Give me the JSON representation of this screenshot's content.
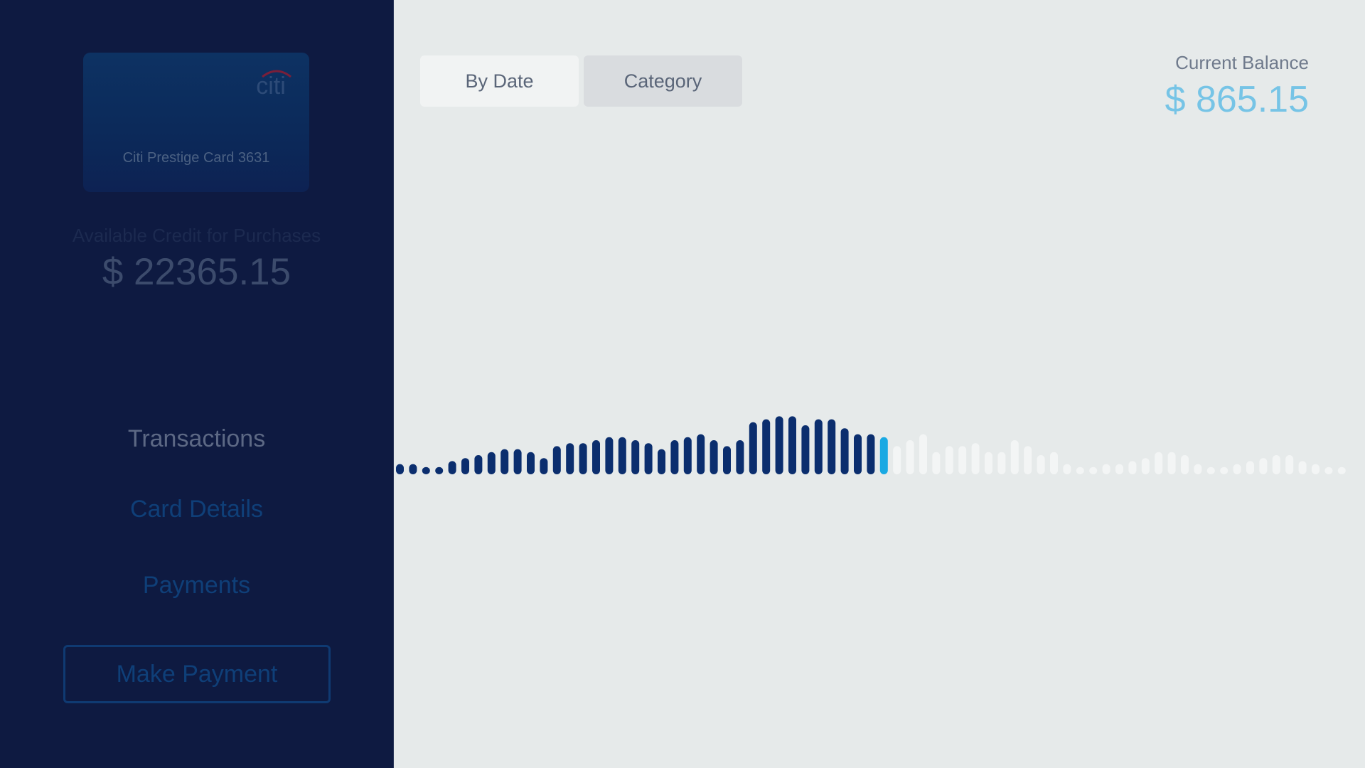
{
  "sidebar": {
    "card": {
      "brand": "citi",
      "name": "Citi Prestige Card 3631",
      "logo_arc_color": "#7a1f3a"
    },
    "available_credit_label": "Available Credit for Purchases",
    "available_credit_value": "$ 22365.15",
    "nav": [
      {
        "label": "Transactions",
        "state": "active"
      },
      {
        "label": "Card Details"
      },
      {
        "label": "Payments"
      }
    ],
    "make_payment_label": "Make Payment"
  },
  "tabs": [
    {
      "label": "By Date",
      "selected": true
    },
    {
      "label": "Category",
      "selected": false
    }
  ],
  "balance": {
    "label": "Current Balance",
    "value": "$ 865.15"
  },
  "colors": {
    "sidebar_bg": "#0e1a41",
    "content_bg": "#e6eaea",
    "past_bar": "#0b2e6e",
    "selected_bar": "#19a9e3",
    "future_bar": "#f3f5f5",
    "balance_accent": "#76c4e6"
  },
  "chart_data": {
    "type": "bar",
    "selected_index": 37,
    "values": [
      1,
      1,
      0.5,
      0.5,
      1.5,
      2,
      2.5,
      3,
      3.5,
      3.5,
      3,
      2,
      4,
      4.5,
      4.5,
      5,
      5.5,
      5.5,
      5,
      4.5,
      3.5,
      5,
      5.5,
      6,
      5,
      4,
      5,
      8,
      8.5,
      9,
      9,
      7.5,
      8.5,
      8.5,
      7,
      6,
      6,
      5.5,
      4,
      5,
      6,
      3,
      4,
      4,
      4.5,
      3,
      3,
      5,
      4,
      2.5,
      3,
      1,
      0.5,
      0.5,
      1,
      1,
      1.5,
      2,
      3,
      3,
      2.5,
      1,
      0.5,
      0.5,
      1,
      1.5,
      2,
      2.5,
      2.5,
      1.5,
      1,
      0.5,
      0.5
    ],
    "ylim": [
      0,
      9
    ]
  }
}
